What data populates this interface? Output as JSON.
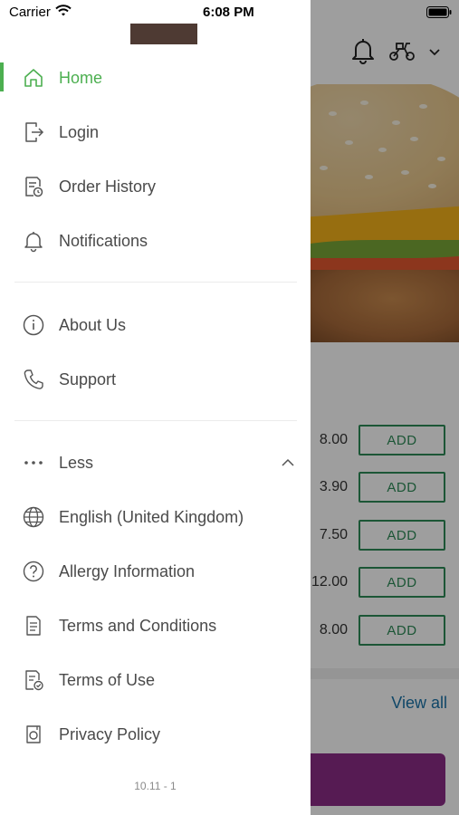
{
  "status_bar": {
    "carrier": "Carrier",
    "time": "6:08 PM",
    "icons": [
      "wifi-icon",
      "battery-icon"
    ]
  },
  "drawer": {
    "menu_primary": [
      {
        "label": "Home",
        "icon": "home-icon",
        "active": true
      },
      {
        "label": "Login",
        "icon": "login-icon"
      },
      {
        "label": "Order History",
        "icon": "order-history-icon"
      },
      {
        "label": "Notifications",
        "icon": "bell-icon"
      }
    ],
    "menu_secondary": [
      {
        "label": "About Us",
        "icon": "info-icon"
      },
      {
        "label": "Support",
        "icon": "phone-icon"
      }
    ],
    "menu_more": [
      {
        "label": "Less",
        "icon": "ellipsis-icon"
      },
      {
        "label": "English (United Kingdom)",
        "icon": "globe-icon"
      },
      {
        "label": "Allergy Information",
        "icon": "question-icon"
      },
      {
        "label": "Terms and Conditions",
        "icon": "document-icon"
      },
      {
        "label": "Terms of Use",
        "icon": "document-check-icon"
      },
      {
        "label": "Privacy Policy",
        "icon": "privacy-icon"
      }
    ],
    "version": "10.11 - 1",
    "accent_color": "#4caf50"
  },
  "background": {
    "prices": [
      "8.00",
      "3.90",
      "7.50",
      "12.00",
      "8.00"
    ],
    "add_label": "ADD",
    "view_all": "View all",
    "header_icons": [
      "bell-icon",
      "scooter-icon",
      "chevron-down-icon"
    ],
    "cta_color": "#8b2c86",
    "button_color": "#2e8b57"
  }
}
